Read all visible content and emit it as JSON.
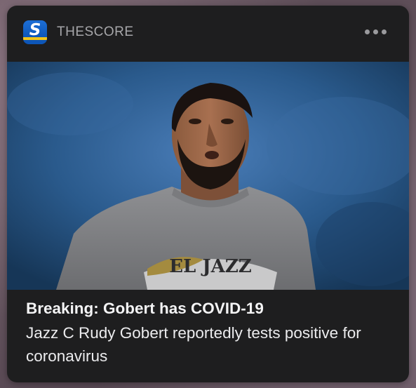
{
  "notification": {
    "app_name": "THESCORE",
    "app_icon_letter": "S",
    "icons": {
      "app": "thescore-app-icon",
      "more": "more-options-icon"
    },
    "image": {
      "description_icon": "news-photo",
      "jersey_text": "EL JAZZ"
    },
    "headline": "Breaking: Gobert has COVID-19",
    "body": "Jazz C Rudy Gobert reportedly tests positive for coronavirus"
  },
  "colors": {
    "card_background": "#1e1e1f",
    "app_icon_blue": "#1d6fd6",
    "app_icon_stripe": "#f0c419",
    "title_text": "#f4f4f5",
    "secondary_text": "#a7a7aa"
  }
}
